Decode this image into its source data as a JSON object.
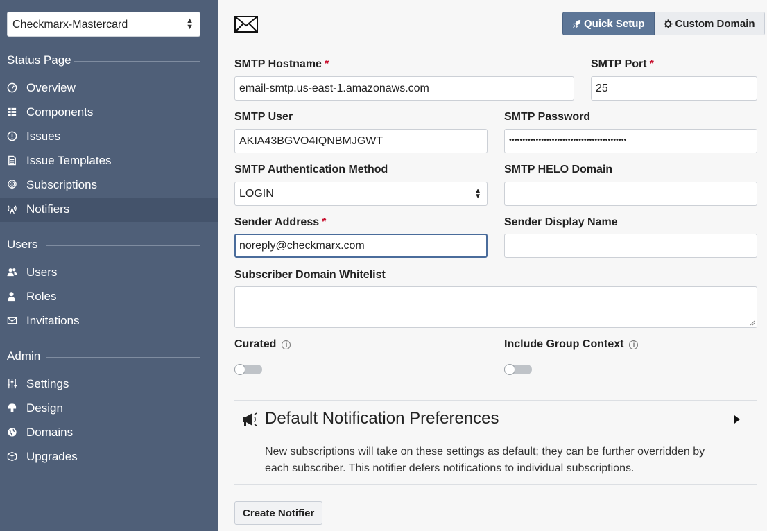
{
  "sidebar": {
    "org_selector": "Checkmarx-Mastercard",
    "sections": {
      "status_page": "Status Page",
      "users": "Users",
      "admin": "Admin"
    },
    "status_items": [
      {
        "label": "Overview",
        "icon": "gauge-icon"
      },
      {
        "label": "Components",
        "icon": "components-icon"
      },
      {
        "label": "Issues",
        "icon": "exclamation-circle-icon"
      },
      {
        "label": "Issue Templates",
        "icon": "document-icon"
      },
      {
        "label": "Subscriptions",
        "icon": "podcast-icon"
      },
      {
        "label": "Notifiers",
        "icon": "broadcast-tower-icon",
        "active": true
      }
    ],
    "user_items": [
      {
        "label": "Users",
        "icon": "users-icon"
      },
      {
        "label": "Roles",
        "icon": "user-icon"
      },
      {
        "label": "Invitations",
        "icon": "envelope-icon"
      }
    ],
    "admin_items": [
      {
        "label": "Settings",
        "icon": "sliders-icon"
      },
      {
        "label": "Design",
        "icon": "paint-icon"
      },
      {
        "label": "Domains",
        "icon": "globe-icon"
      },
      {
        "label": "Upgrades",
        "icon": "box-icon"
      }
    ]
  },
  "toolbar": {
    "quick_setup": "Quick Setup",
    "custom_domain": "Custom Domain"
  },
  "form": {
    "smtp_hostname_label": "SMTP Hostname",
    "smtp_hostname_value": "email-smtp.us-east-1.amazonaws.com",
    "smtp_port_label": "SMTP Port",
    "smtp_port_value": "25",
    "smtp_user_label": "SMTP User",
    "smtp_user_value": "AKIA43BGVO4IQNBMJGWT",
    "smtp_password_label": "SMTP Password",
    "smtp_password_value": "••••••••••••••••••••••••••••••••••••••••••••",
    "smtp_auth_label": "SMTP Authentication Method",
    "smtp_auth_value": "LOGIN",
    "smtp_helo_label": "SMTP HELO Domain",
    "smtp_helo_value": "",
    "sender_address_label": "Sender Address",
    "sender_address_value": "noreply@checkmarx.com",
    "sender_display_label": "Sender Display Name",
    "sender_display_value": "",
    "whitelist_label": "Subscriber Domain Whitelist",
    "curated_label": "Curated",
    "group_context_label": "Include Group Context",
    "required_mark": "*",
    "info_mark": "i"
  },
  "preferences": {
    "title": "Default Notification Preferences",
    "description": "New subscriptions will take on these settings as default; they can be further overridden by each subscriber. This notifier defers notifications to individual subscriptions."
  },
  "actions": {
    "create": "Create Notifier"
  }
}
